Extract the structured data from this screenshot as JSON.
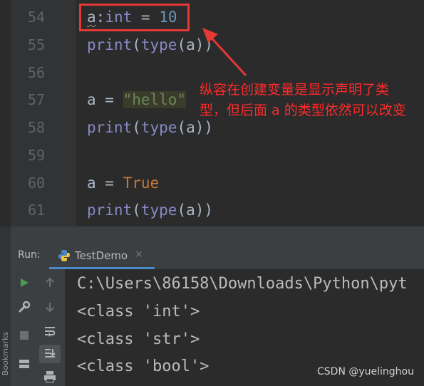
{
  "editor": {
    "lines": [
      {
        "number": "54"
      },
      {
        "number": "55"
      },
      {
        "number": "56"
      },
      {
        "number": "57"
      },
      {
        "number": "58"
      },
      {
        "number": "59"
      },
      {
        "number": "60"
      },
      {
        "number": "61"
      }
    ],
    "code": {
      "l54_var": "a",
      "l54_colon": ":",
      "l54_type": "int",
      "l54_eq": " = ",
      "l54_val": "10",
      "l55_print": "print",
      "l55_open": "(",
      "l55_type": "type",
      "l55_rest": "(a))",
      "l57_lhs": "a = ",
      "l57_str": "\"hello\"",
      "l58_print": "print",
      "l58_open": "(",
      "l58_type": "type",
      "l58_rest": "(a))",
      "l60_lhs": "a = ",
      "l60_val": "True",
      "l61_print": "print",
      "l61_open": "(",
      "l61_type": "type",
      "l61_rest": "(a))"
    },
    "annotation_line1": "纵容在创建变量是显示声明了类",
    "annotation_line2": "型，但后面 a 的类型依然可以改变",
    "annotation_color": "#ff2a2a"
  },
  "run_panel": {
    "label": "Run:",
    "tab_label": "TestDemo",
    "tab_close": "×",
    "output_lines": [
      "C:\\Users\\86158\\Downloads\\Python\\pyt",
      "<class 'int'>",
      "<class 'str'>",
      "<class 'bool'>"
    ]
  },
  "side": {
    "bookmarks_label": "Bookmarks"
  },
  "watermark": "CSDN @yuelinghou",
  "colors": {
    "background": "#2b2b2b",
    "panel": "#3c3f41",
    "accent": "#4a88c7",
    "run_green": "#499c54"
  }
}
